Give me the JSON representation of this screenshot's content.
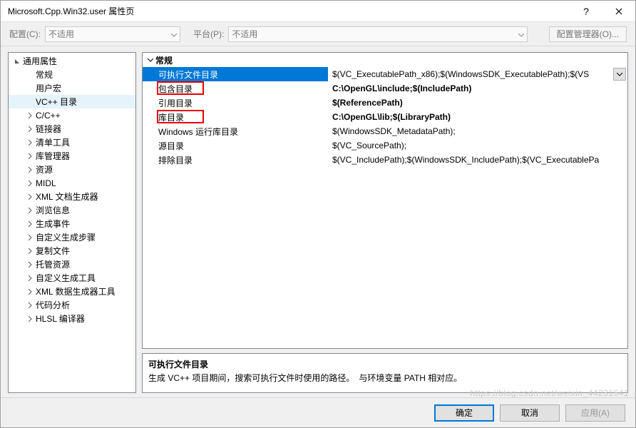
{
  "titlebar": {
    "title": "Microsoft.Cpp.Win32.user 属性页"
  },
  "config": {
    "config_label": "配置(C):",
    "config_value": "不适用",
    "platform_label": "平台(P):",
    "platform_value": "不适用",
    "manager_btn": "配置管理器(O)..."
  },
  "sidebar": {
    "root": "通用属性",
    "items": [
      {
        "label": "常规",
        "caret": false
      },
      {
        "label": "用户宏",
        "caret": false
      },
      {
        "label": "VC++ 目录",
        "caret": false,
        "selected": true
      },
      {
        "label": "C/C++",
        "caret": true
      },
      {
        "label": "链接器",
        "caret": true
      },
      {
        "label": "清单工具",
        "caret": true
      },
      {
        "label": "库管理器",
        "caret": true
      },
      {
        "label": "资源",
        "caret": true
      },
      {
        "label": "MIDL",
        "caret": true
      },
      {
        "label": "XML 文档生成器",
        "caret": true
      },
      {
        "label": "浏览信息",
        "caret": true
      },
      {
        "label": "生成事件",
        "caret": true
      },
      {
        "label": "自定义生成步骤",
        "caret": true
      },
      {
        "label": "复制文件",
        "caret": true
      },
      {
        "label": "托管资源",
        "caret": true
      },
      {
        "label": "自定义生成工具",
        "caret": true
      },
      {
        "label": "XML 数据生成器工具",
        "caret": true
      },
      {
        "label": "代码分析",
        "caret": true
      },
      {
        "label": "HLSL 编译器",
        "caret": true
      }
    ]
  },
  "grid": {
    "section": "常规",
    "rows": [
      {
        "name": "可执行文件目录",
        "value": "$(VC_ExecutablePath_x86);$(WindowsSDK_ExecutablePath);$(VS",
        "selected": true,
        "bold": false,
        "redbox": false,
        "dropdown": true
      },
      {
        "name": "包含目录",
        "value": "C:\\OpenGL\\include;$(IncludePath)",
        "bold": true,
        "redbox": true
      },
      {
        "name": "引用目录",
        "value": "$(ReferencePath)",
        "bold": true
      },
      {
        "name": "库目录",
        "value": "C:\\OpenGL\\lib;$(LibraryPath)",
        "bold": true,
        "redbox": true
      },
      {
        "name": "Windows 运行库目录",
        "value": "$(WindowsSDK_MetadataPath);"
      },
      {
        "name": "源目录",
        "value": "$(VC_SourcePath);"
      },
      {
        "name": "排除目录",
        "value": "$(VC_IncludePath);$(WindowsSDK_IncludePath);$(VC_ExecutablePa"
      }
    ]
  },
  "desc": {
    "title": "可执行文件目录",
    "body": "生成 VC++ 项目期间，搜索可执行文件时使用的路径。　与环境变量 PATH 相对应。"
  },
  "footer": {
    "ok": "确定",
    "cancel": "取消",
    "apply": "应用(A)"
  },
  "watermark": "https://blog.csdn.net/weixin_44231641"
}
